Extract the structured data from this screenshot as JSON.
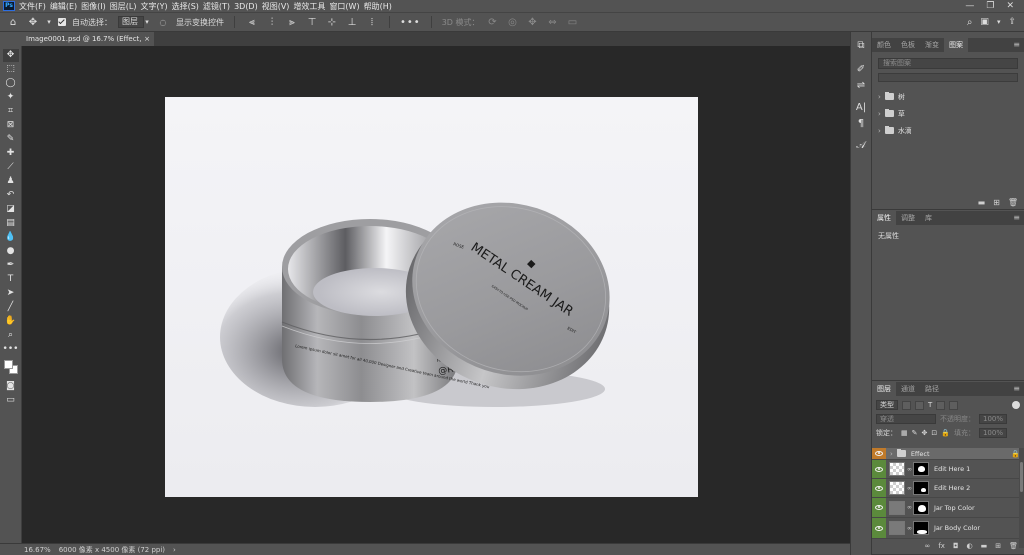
{
  "menubar": {
    "logo": "Ps",
    "items": [
      "文件(F)",
      "编辑(E)",
      "图像(I)",
      "图层(L)",
      "文字(Y)",
      "选择(S)",
      "滤镜(T)",
      "3D(D)",
      "视图(V)",
      "增效工具",
      "窗口(W)",
      "帮助(H)"
    ],
    "minimize": "—",
    "restore": "❐",
    "close": "✕"
  },
  "options": {
    "auto_select_label": "自动选择：",
    "auto_select_target": "图层",
    "show_transform_label": "显示变换控件",
    "mode_3d_label": "3D 模式："
  },
  "document": {
    "tab_title": "Image0001.psd @ 16.7% (Effect, RGB/8#)",
    "tab_close": "×"
  },
  "status": {
    "zoom": "16.67%",
    "size": "6000 像素 x 4500 像素 (72 ppi)",
    "arrow": "›"
  },
  "libraries_panel": {
    "tabs": [
      "颜色",
      "色板",
      "渐变",
      "图案"
    ],
    "active_tab": 3,
    "search_placeholder": "搜索图案",
    "groups": [
      "树",
      "草",
      "水滴"
    ]
  },
  "properties_panel": {
    "tabs": [
      "属性",
      "调整",
      "库"
    ],
    "active_tab": 0,
    "empty_text": "无属性"
  },
  "layers_panel": {
    "tabs": [
      "图层",
      "通道",
      "路径"
    ],
    "active_tab": 0,
    "filter_kind": "类型",
    "blend_mode": "穿透",
    "opacity_label": "不透明度：",
    "opacity_value": "100%",
    "lock_label": "锁定：",
    "fill_label": "填充：",
    "fill_value": "100%",
    "layers": [
      {
        "name": "Effect",
        "kind": "group",
        "eye_color": "#c07a2a",
        "locked": true
      },
      {
        "name": "Edit Here 1",
        "kind": "smart",
        "eye_color": "#5b8a3c"
      },
      {
        "name": "Edit Here 2",
        "kind": "smart",
        "eye_color": "#5b8a3c"
      },
      {
        "name": "Jar Top Color",
        "kind": "fill",
        "eye_color": "#5b8a3c"
      },
      {
        "name": "Jar Body Color",
        "kind": "fill",
        "eye_color": "#5b8a3c"
      }
    ]
  },
  "artwork": {
    "lid_title": "METAL CREAM JAR",
    "lid_top_left": "ROSE",
    "lid_right": "EDIT",
    "lid_sub": "EASY-TO-USE PSD MOCKUP",
    "body_text": "Lorem ipsum dolor sit amet for all 40,000 Designer and Creative team around the world Thank you",
    "handle_prefix": "Follow Me",
    "handle": "@River"
  },
  "icons": {
    "home": "home-icon",
    "move": "move-tool-icon",
    "search": "search-icon",
    "workspace": "workspace-icon",
    "share": "share-icon"
  }
}
